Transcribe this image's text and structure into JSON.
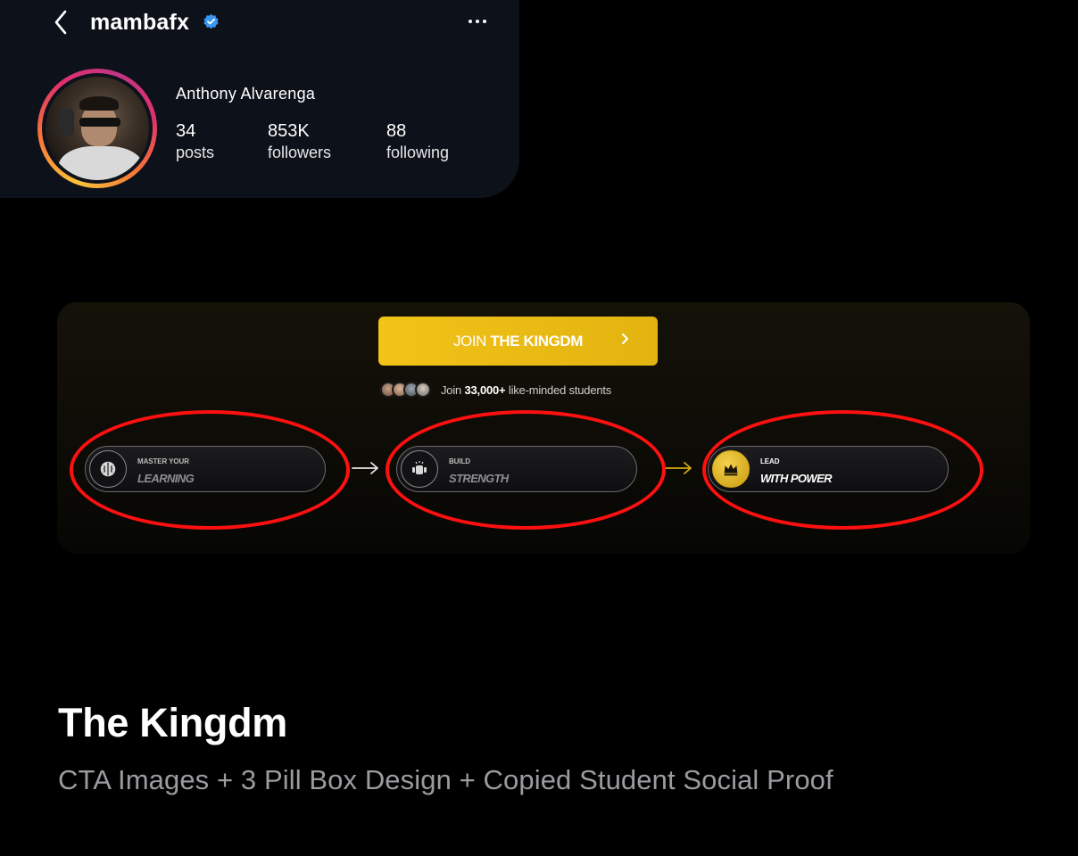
{
  "profile": {
    "username": "mambafx",
    "full_name": "Anthony Alvarenga",
    "stats": [
      {
        "value": "34",
        "label": "posts"
      },
      {
        "value": "853K",
        "label": "followers"
      },
      {
        "value": "88",
        "label": "following"
      }
    ],
    "icons": {
      "back": "chevron-left-icon",
      "verified": "verified-badge-icon",
      "more": "more-horizontal-icon"
    }
  },
  "banner": {
    "cta_prefix": "JOIN",
    "cta_bold": "THE KINGDM",
    "social_prefix": "Join",
    "social_count": "33,000+",
    "social_suffix": "like-minded students",
    "pills": [
      {
        "small": "MASTER YOUR",
        "big": "LEARNING",
        "icon": "brain-icon"
      },
      {
        "small": "BUILD",
        "big": "STRENGTH",
        "icon": "dumbbell-icon"
      },
      {
        "small": "LEAD",
        "big": "WITH POWER",
        "icon": "crown-icon"
      }
    ],
    "accent": "#f2c318",
    "annotation_color": "#ff1010"
  },
  "caption": {
    "title": "The Kingdm",
    "subtitle": "CTA Images + 3 Pill Box Design + Copied Student Social Proof"
  }
}
